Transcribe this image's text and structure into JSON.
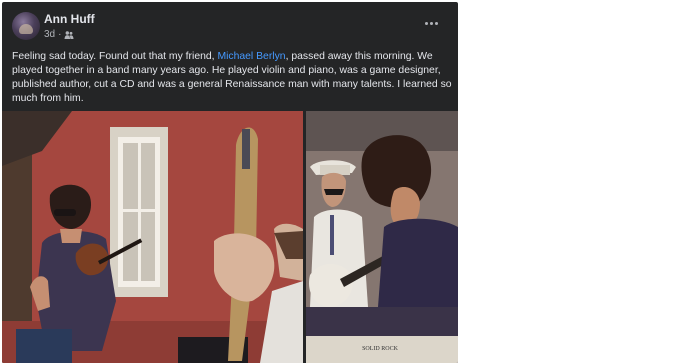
{
  "post": {
    "author": "Ann Huff",
    "time": "3d",
    "separator": "·",
    "audience_icon": "friends-icon",
    "text_before": "Feeling sad today. Found out that my friend, ",
    "mention": "Michael Berlyn",
    "text_after": ", passed away this morning. We played together in a band many years ago. He played violin and piano, was a game designer, published author, cut a CD and was a general Renaissance man with many talents. I learned so much from him.",
    "more_icon": "more-options-icon"
  },
  "photos": {
    "right_caption": "SOLID ROCK"
  },
  "colors": {
    "card_bg": "#242526",
    "text": "#e4e6eb",
    "secondary_text": "#b0b3b8",
    "link": "#4599ff"
  }
}
